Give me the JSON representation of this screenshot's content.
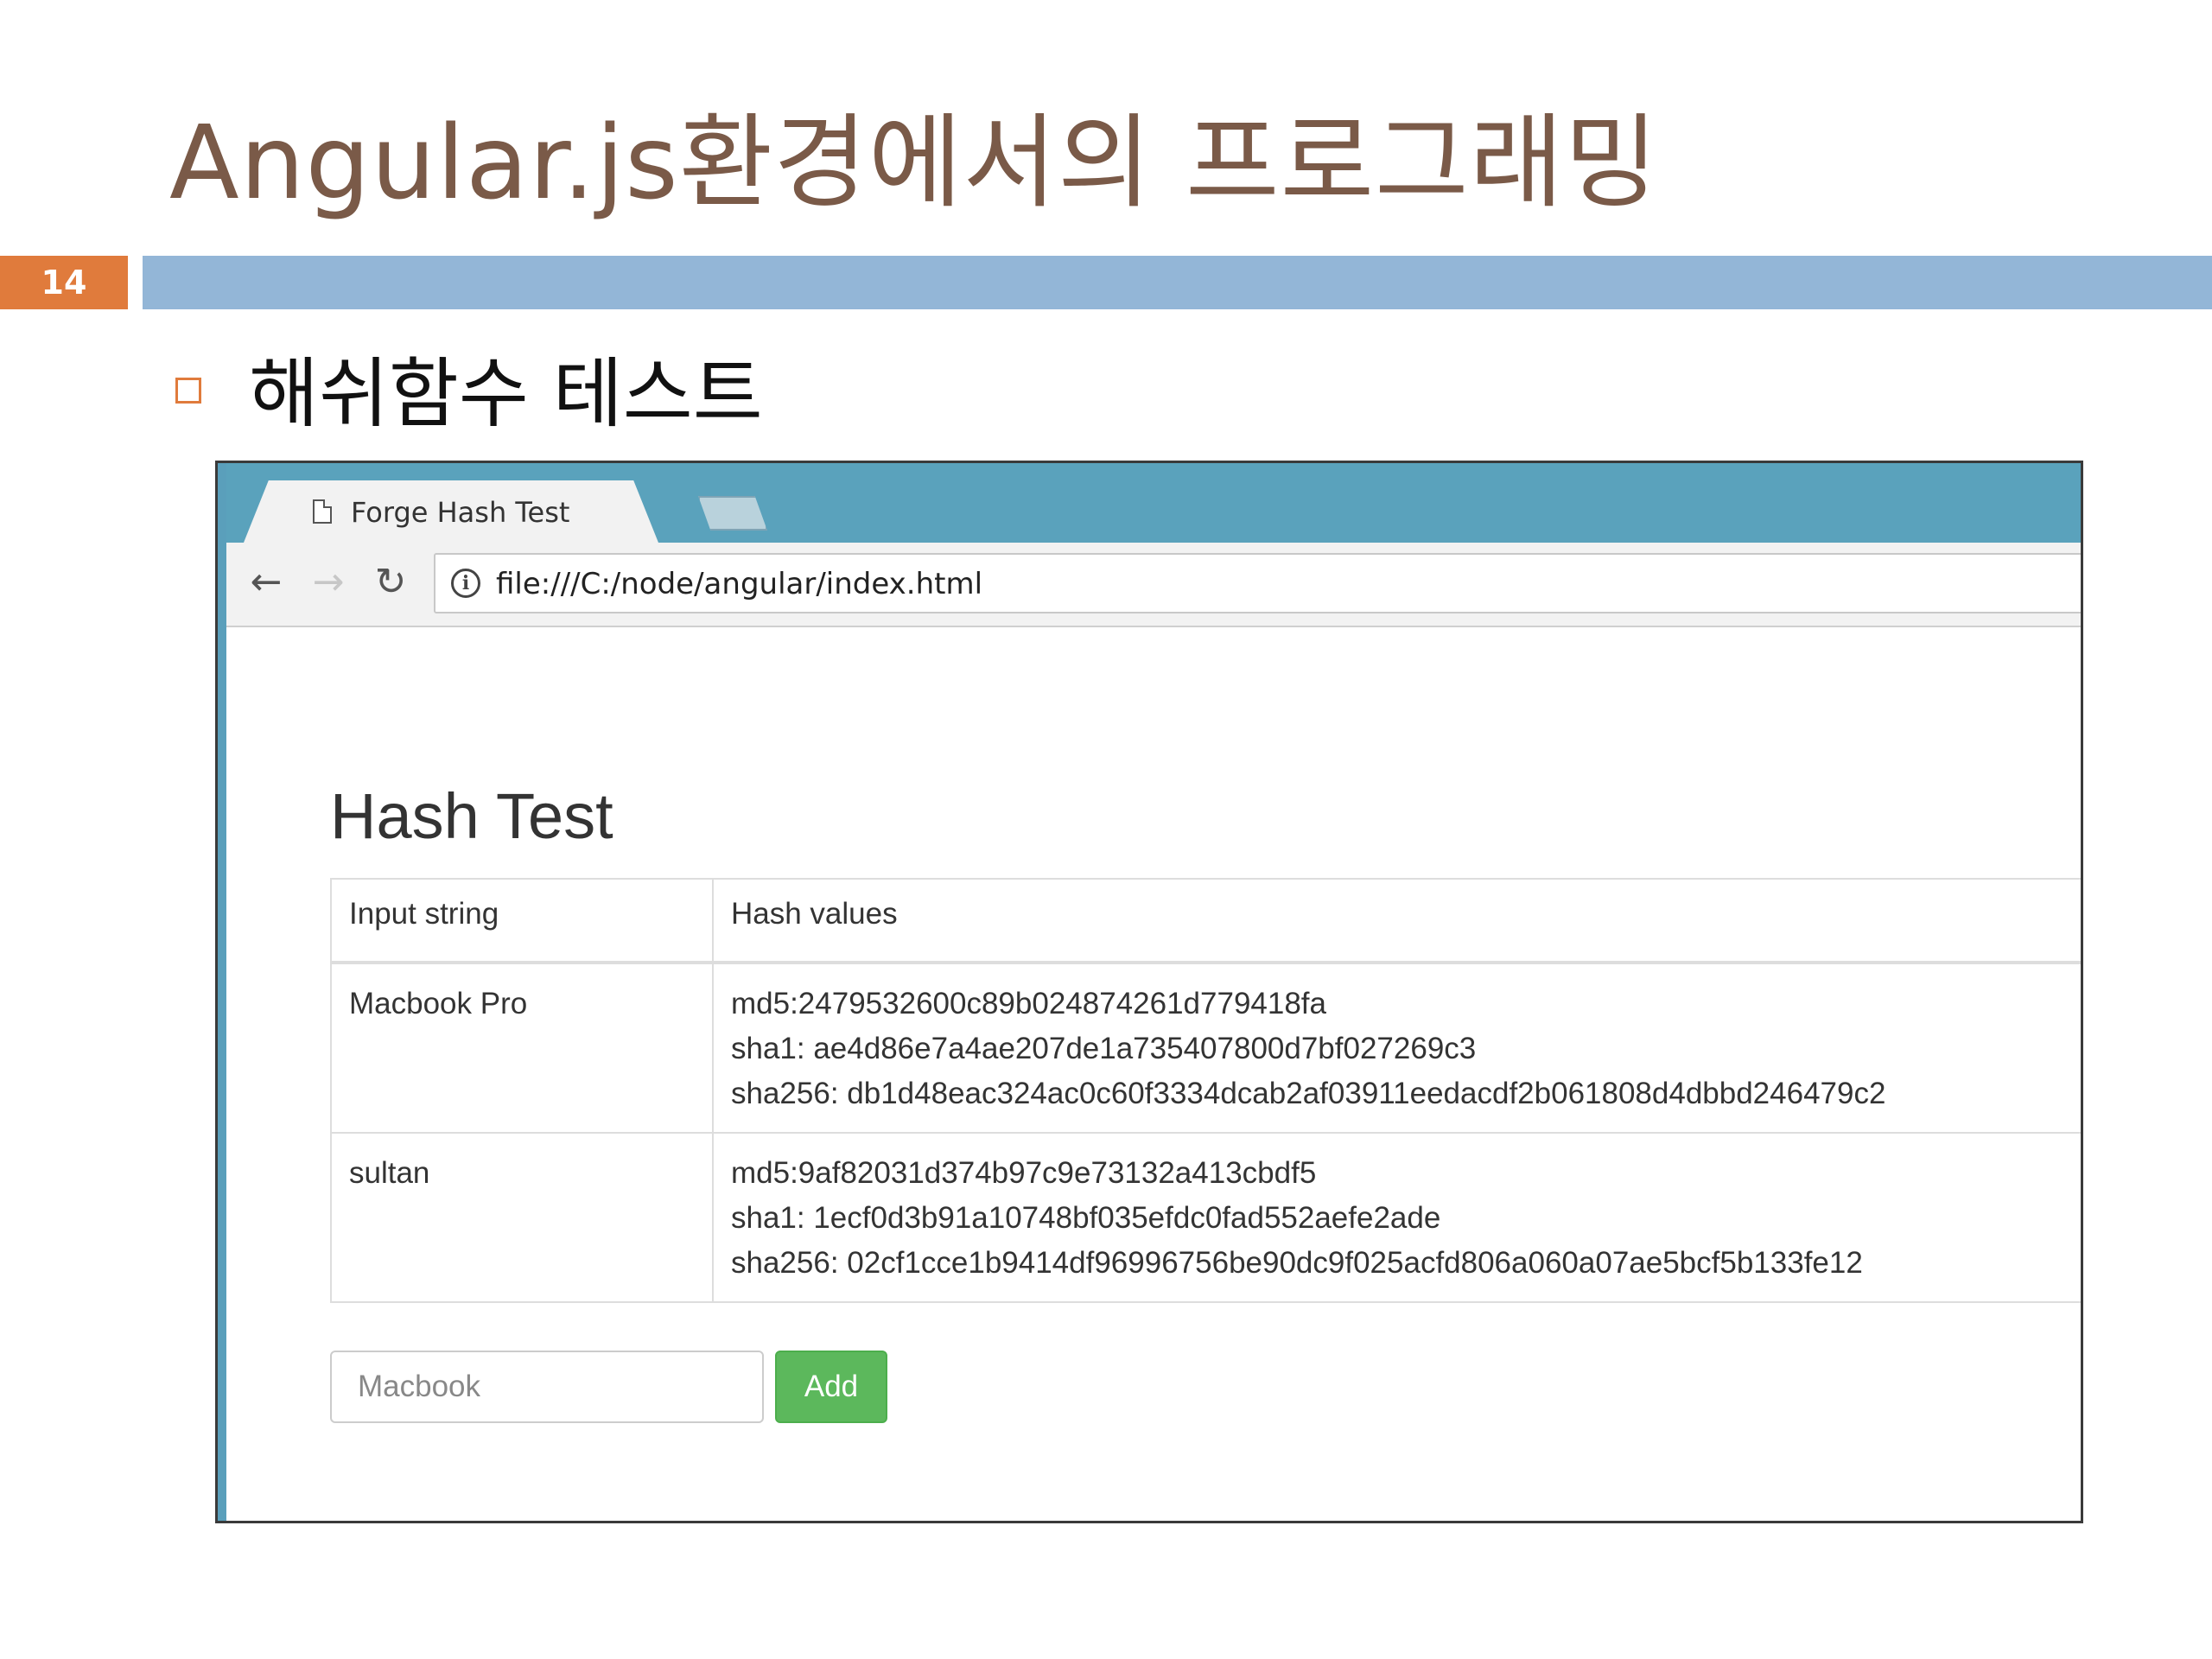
{
  "slide": {
    "title": "Angular.js환경에서의 프로그래밍",
    "page_number": "14",
    "bullet": "해쉬함수 테스트"
  },
  "browser": {
    "tab_title": "Forge Hash Test",
    "tab_close": "×",
    "address": "file:///C:/node/angular/index.html",
    "info_glyph": "i",
    "nav": {
      "back": "←",
      "forward": "→",
      "reload": "↻"
    }
  },
  "page": {
    "heading": "Hash Test",
    "table": {
      "headers": [
        "Input string",
        "Hash values"
      ],
      "rows": [
        {
          "input": "Macbook Pro",
          "md5": "md5:2479532600c89b024874261d779418fa",
          "sha1": "sha1: ae4d86e7a4ae207de1a735407800d7bf027269c3",
          "sha256": "sha256: db1d48eac324ac0c60f3334dcab2af03911eedacdf2b061808d4dbbd246479c2"
        },
        {
          "input": "sultan",
          "md5": "md5:9af82031d374b97c9e73132a413cbdf5",
          "sha1": "sha1: 1ecf0d3b91a10748bf035efdc0fad552aefe2ade",
          "sha256": "sha256: 02cf1cce1b9414df96996756be90dc9f025acfd806a060a07ae5bcf5b133fe12"
        }
      ]
    },
    "input_placeholder": "Macbook",
    "add_label": "Add"
  },
  "colors": {
    "title_text": "#7a5a48",
    "page_badge": "#e07b3c",
    "title_bar": "#93b6d7",
    "tabstrip": "#5aa2bc",
    "add_button": "#5cb85c"
  }
}
